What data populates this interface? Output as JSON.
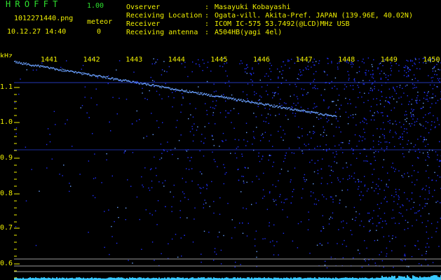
{
  "header": {
    "app_title": "HROFFT",
    "app_version": "1.00",
    "file_name": "1012271440.png",
    "meteor_label": "meteor",
    "datetime": "10.12.27 14:40",
    "meteor_count": "0",
    "info": [
      {
        "label": "Ovserver",
        "value": "Masayuki Kobayashi"
      },
      {
        "label": "Receiving Location",
        "value": "Ogata-vill. Akita-Pref. JAPAN (139.96E, 40.02N)"
      },
      {
        "label": "Receiver",
        "value": "ICOM IC-575 53.7492(@LCD)MHz USB"
      },
      {
        "label": "Receiving antenna",
        "value": "A504HB(yagi 4el)"
      }
    ],
    "separator": ":"
  },
  "spectrogram": {
    "unit": "kHz",
    "y_ticks": [
      "1.1",
      "1.0",
      "0.9",
      "0.8",
      "0.7",
      "0.6"
    ],
    "x_ticks": [
      "1441",
      "1442",
      "1443",
      "1444",
      "1445",
      "1446",
      "1447",
      "1448",
      "1449",
      "1450"
    ],
    "colors": {
      "signal": "#2030ff",
      "bright": "#6aa0ff",
      "text": "#f0f000",
      "grid": "#9a9a9a"
    }
  }
}
